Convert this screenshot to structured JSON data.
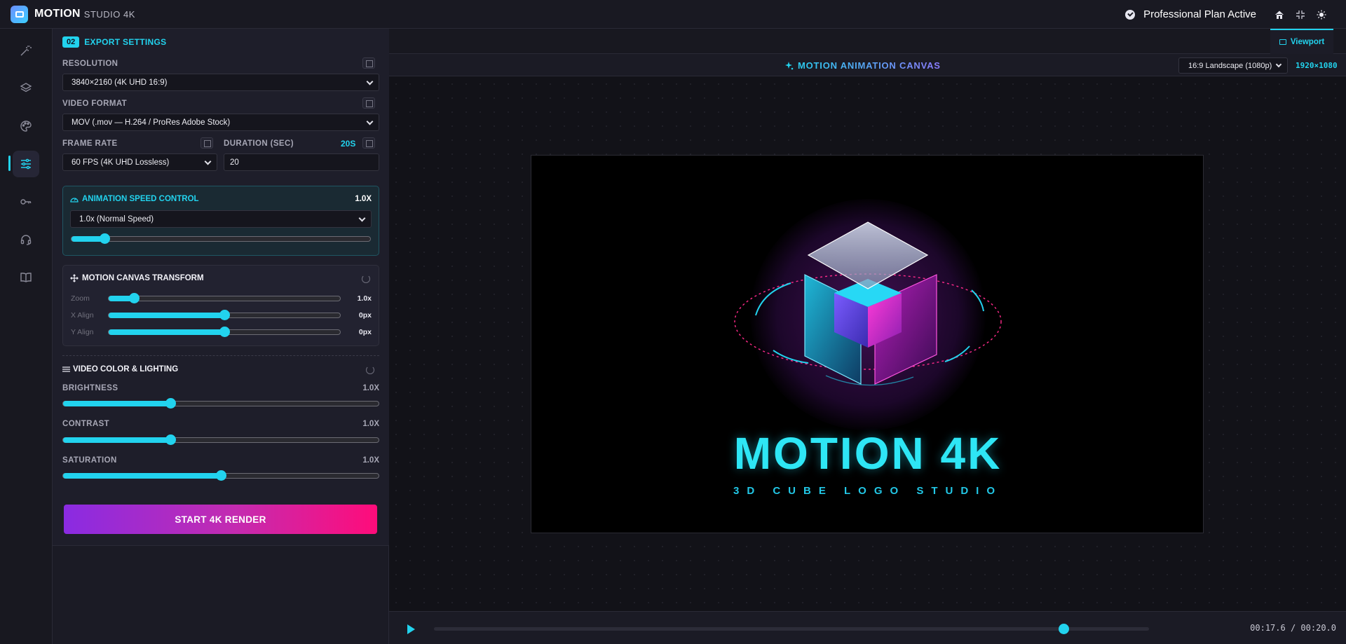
{
  "header": {
    "brand": "MOTION",
    "brand_sub": "STUDIO 4K",
    "plan": "Professional Plan Active"
  },
  "rail": {
    "items": [
      "magic-wand",
      "layers",
      "palette",
      "sliders",
      "key",
      "headset",
      "book"
    ],
    "active": "sliders"
  },
  "sidebar": {
    "section_number": "02",
    "section_title": "EXPORT SETTINGS",
    "resolution": {
      "label": "RESOLUTION",
      "value": "3840×2160 (4K UHD 16:9)"
    },
    "video_format": {
      "label": "VIDEO FORMAT",
      "value": "MOV (.mov — H.264 / ProRes Adobe Stock)"
    },
    "frame_rate": {
      "label": "FRAME RATE",
      "value": "60 FPS (4K UHD Lossless)"
    },
    "duration": {
      "label": "DURATION (SEC)",
      "display": "20S",
      "value": "20"
    },
    "speed": {
      "title": "ANIMATION SPEED CONTROL",
      "value_label": "1.0X",
      "select": "1.0x (Normal Speed)",
      "slider_fraction": 0.11
    },
    "transform": {
      "title": "MOTION CANVAS TRANSFORM",
      "rows": [
        {
          "label": "Zoom",
          "value": "1.0x",
          "fraction": 0.11
        },
        {
          "label": "X Align",
          "value": "0px",
          "fraction": 0.5
        },
        {
          "label": "Y Align",
          "value": "0px",
          "fraction": 0.5
        }
      ]
    },
    "color": {
      "title": "VIDEO COLOR & LIGHTING",
      "rows": [
        {
          "label": "BRIGHTNESS",
          "value": "1.0X",
          "fraction": 0.34
        },
        {
          "label": "CONTRAST",
          "value": "1.0X",
          "fraction": 0.34
        },
        {
          "label": "SATURATION",
          "value": "1.0X",
          "fraction": 0.5
        }
      ]
    },
    "render_button": "START 4K RENDER"
  },
  "main": {
    "tab": "Viewport",
    "canvas_title": "MOTION ANIMATION CANVAS",
    "aspect": "16:9 Landscape (1080p)",
    "resolution": "1920×1080",
    "title": "MOTION 4K",
    "subtitle": "3D CUBE LOGO STUDIO",
    "playback": {
      "current": "00:17.6",
      "total": "00:20.0",
      "fraction": 0.88
    }
  },
  "colors": {
    "accent": "#22d3ee",
    "magenta": "#ff0c7a",
    "purple": "#8a2be2"
  }
}
